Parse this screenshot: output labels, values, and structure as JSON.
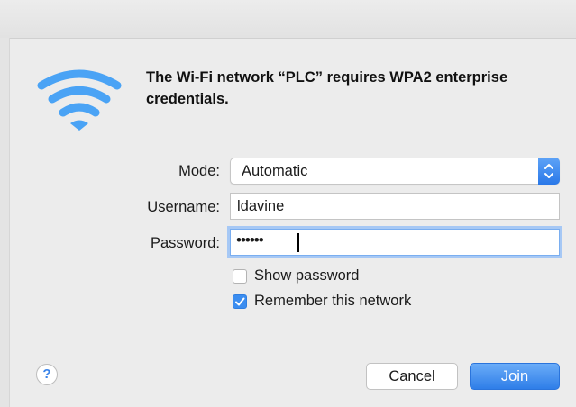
{
  "dialog": {
    "heading": "The Wi-Fi network “PLC” requires WPA2 enterprise credentials."
  },
  "form": {
    "mode_label": "Mode:",
    "mode_value": "Automatic",
    "username_label": "Username:",
    "username_value": "ldavine",
    "password_label": "Password:",
    "password_mask": "••••••"
  },
  "options": {
    "show_password": {
      "label": "Show password",
      "checked": false
    },
    "remember_network": {
      "label": "Remember this network",
      "checked": true
    }
  },
  "buttons": {
    "help": "?",
    "cancel": "Cancel",
    "join": "Join"
  },
  "colors": {
    "accent": "#3b8df0",
    "wifi": "#4aa3f5"
  },
  "icons": {
    "wifi": "wifi-icon",
    "stepper": "up-down-chevron-icon",
    "checkmark": "checkmark-icon"
  }
}
